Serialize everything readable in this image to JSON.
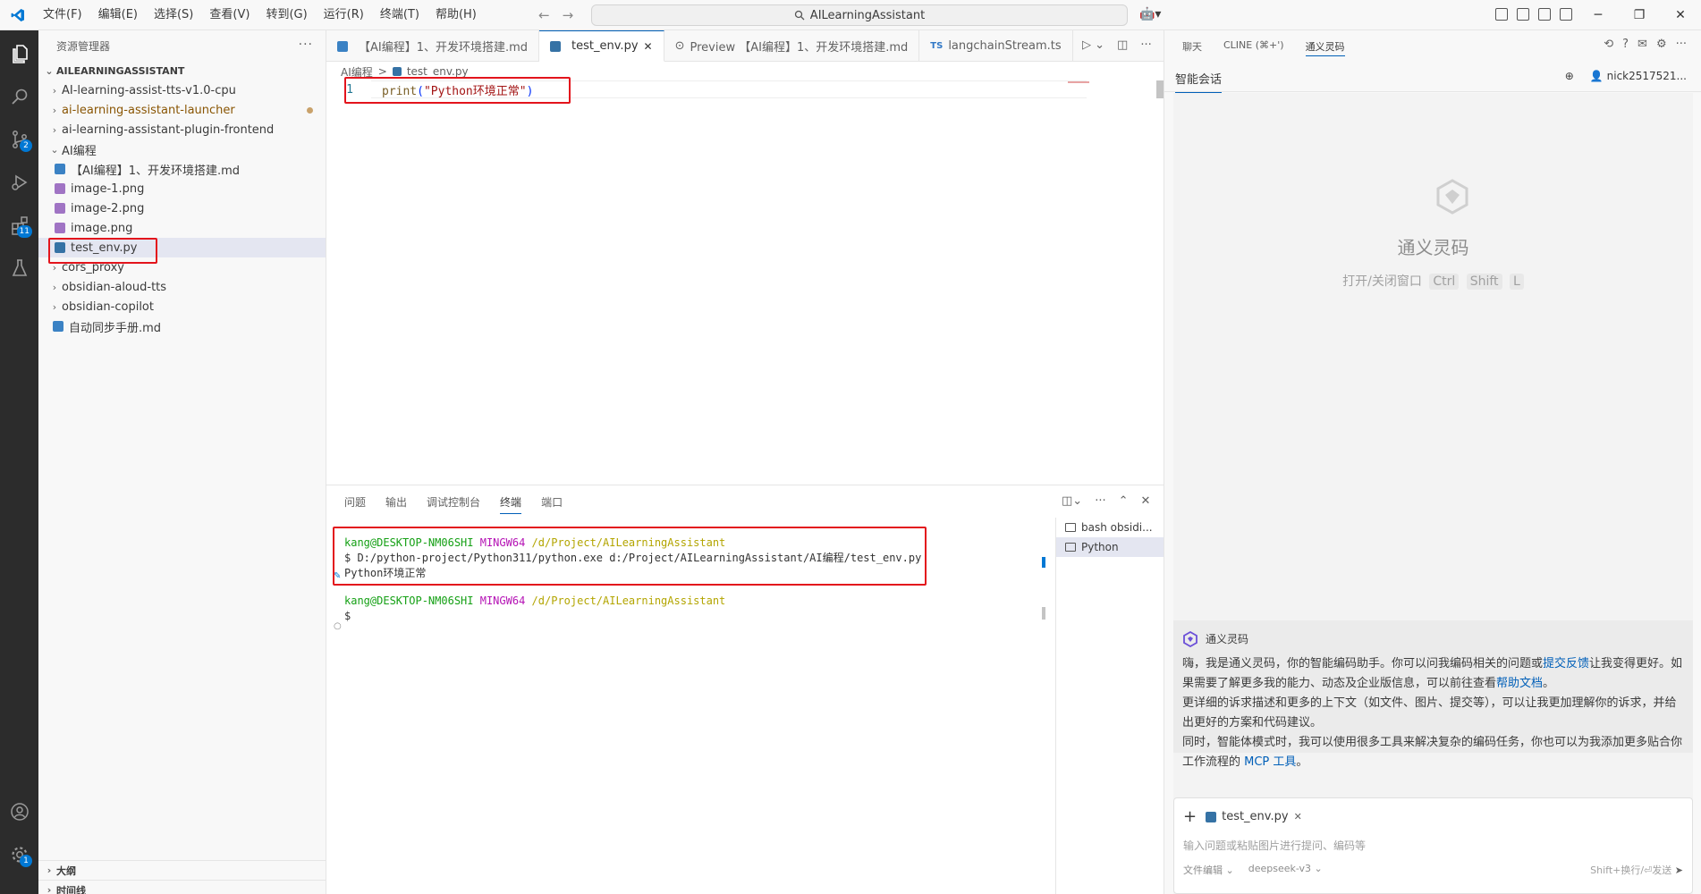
{
  "app": {
    "menu": [
      "文件(F)",
      "编辑(E)",
      "选择(S)",
      "查看(V)",
      "转到(G)",
      "运行(R)",
      "终端(T)",
      "帮助(H)"
    ],
    "search_text": "AILearningAssistant",
    "colors": {
      "accent": "#005fb8",
      "activity_bar": "#2c2c2c",
      "highlight": "#e3141c"
    }
  },
  "activity_bar": {
    "source_control_badge": "2",
    "extensions_badge": "11",
    "settings_badge": "1"
  },
  "explorer": {
    "title": "资源管理器",
    "more": "···",
    "root": "AILEARNINGASSISTANT",
    "items": [
      {
        "label": "AI-learning-assist-tts-v1.0-cpu",
        "type": "folder"
      },
      {
        "label": "ai-learning-assistant-launcher",
        "type": "folder"
      },
      {
        "label": "ai-learning-assistant-plugin-frontend",
        "type": "folder"
      },
      {
        "label": "AI编程",
        "type": "folder"
      },
      {
        "label": "【AI编程】1、开发环境搭建.md",
        "type": "md"
      },
      {
        "label": "image-1.png",
        "type": "png"
      },
      {
        "label": "image-2.png",
        "type": "png"
      },
      {
        "label": "image.png",
        "type": "png"
      },
      {
        "label": "test_env.py",
        "type": "py"
      },
      {
        "label": "cors_proxy",
        "type": "folder"
      },
      {
        "label": "obsidian-aloud-tts",
        "type": "folder"
      },
      {
        "label": "obsidian-copilot",
        "type": "folder"
      },
      {
        "label": "自动同步手册.md",
        "type": "md"
      }
    ],
    "outline": "大纲",
    "timeline": "时间线"
  },
  "tabs": [
    {
      "label": "【AI编程】1、开发环境搭建.md"
    },
    {
      "label": "test_env.py"
    },
    {
      "label": "Preview 【AI编程】1、开发环境搭建.md"
    },
    {
      "label": "langchainStream.ts"
    }
  ],
  "breadcrumb": {
    "folder": "AI编程",
    "sep": ">",
    "file": "test_env.py"
  },
  "editor": {
    "line_number": "1",
    "fn": "print",
    "open_paren": "(",
    "string": "\"Python环境正常\"",
    "close_paren": ")"
  },
  "panel": {
    "tabs": [
      "问题",
      "输出",
      "调试控制台",
      "终端",
      "端口"
    ],
    "terminal": {
      "user": "kang@DESKTOP-NM06SHI",
      "host": "MINGW64",
      "path": "/d/Project/AILearningAssistant",
      "command": "$ D:/python-project/Python311/python.exe d:/Project/AILearningAssistant/AI编程/test_env.py",
      "output": "Python环境正常",
      "prompt": "$"
    },
    "terminal_list": [
      "bash obsidi...",
      "Python"
    ]
  },
  "right_panel": {
    "tabs": [
      "聊天",
      "CLINE (⌘+')",
      "通义灵码"
    ],
    "session_title": "智能会话",
    "user_name": "nick2517521...",
    "brand_name": "通义灵码",
    "shortcut_label": "打开/关闭窗口",
    "shortcut_keys": [
      "Ctrl",
      "Shift",
      "L"
    ],
    "welcome": {
      "name": "通义灵码",
      "p1a": "嗨，我是通义灵码，你的智能编码助手。你可以问我编码相关的问题或",
      "p1_link": "提交反馈",
      "p1b": "让我变得更好。如果需要了解更多我的能力、动态及企业版信息，可以前往查看",
      "p1_link2": "帮助文档",
      "p1c": "。",
      "p2": "更详细的诉求描述和更多的上下文（如文件、图片、提交等），可以让我更加理解你的诉求，并给出更好的方案和代码建议。",
      "p3a": "同时，智能体模式时，我可以使用很多工具来解决复杂的编码任务，你也可以为我添加更多贴合你工作流程的 ",
      "p3_link": "MCP 工具",
      "p3b": "。"
    },
    "input": {
      "context_file": "test_env.py",
      "placeholder": "输入问题或粘贴图片进行提问、编码等",
      "mode": "文件编辑",
      "model": "deepseek-v3",
      "send_hint": "Shift+换行/⏎发送"
    }
  }
}
